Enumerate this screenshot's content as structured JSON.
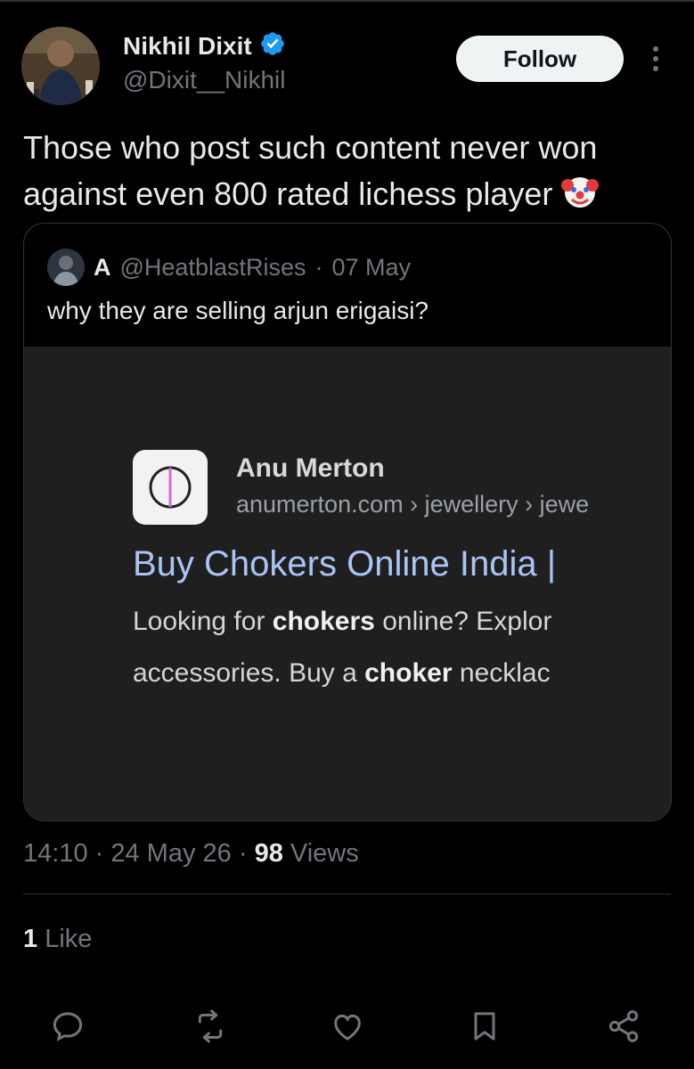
{
  "author": {
    "display_name": "Nikhil Dixit",
    "handle": "@Dixit__Nikhil",
    "verified": true,
    "verified_color": "#1d9bf0"
  },
  "follow_label": "Follow",
  "tweet": {
    "text": "Those who post such content never won against even 800 rated lichess player",
    "emoji": "clown-face"
  },
  "quote": {
    "name": "A",
    "handle": "@HeatblastRises",
    "date": "07 May",
    "text": "why they are selling arjun erigaisi?",
    "media": {
      "site_name": "Anu Merton",
      "site_url": "anumerton.com › jewellery › jewe",
      "title": "Buy Chokers Online India | ",
      "snippet_line1": {
        "pre": "Looking for ",
        "bold": "chokers",
        "post": " online? Explor"
      },
      "snippet_line2": {
        "pre": "accessories. Buy a ",
        "bold": "choker",
        "post": " necklac"
      }
    }
  },
  "meta": {
    "time": "14:10",
    "date": "24 May 26",
    "views_count": "98",
    "views_label": "Views"
  },
  "likes": {
    "count": "1",
    "label": "Like"
  },
  "actions": [
    "reply-icon",
    "retweet-icon",
    "like-icon",
    "bookmark-icon",
    "share-icon"
  ]
}
